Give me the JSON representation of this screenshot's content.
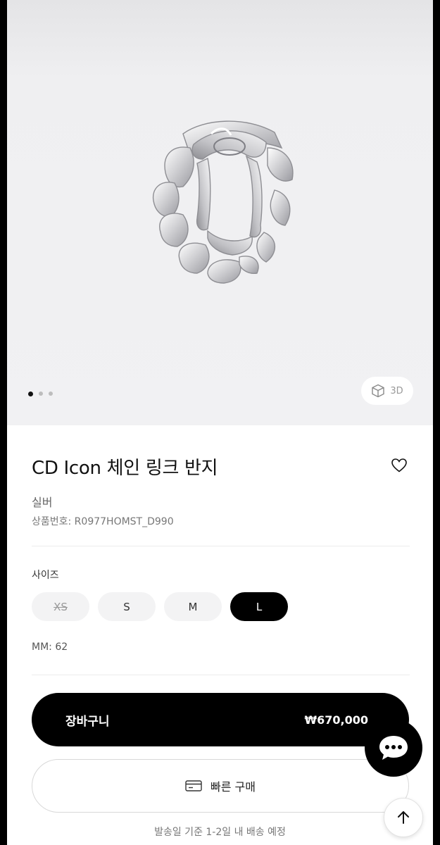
{
  "gallery": {
    "image_alt": "ring-product-image",
    "dots_count": 3,
    "active_dot": 0,
    "view_3d_label": "3D"
  },
  "product": {
    "title": "CD Icon 체인 링크 반지",
    "color": "실버",
    "sku": "상품번호: R0977HOMST_D990"
  },
  "size": {
    "label": "사이즈",
    "options": [
      {
        "label": "XS",
        "state": "disabled"
      },
      {
        "label": "S",
        "state": "available"
      },
      {
        "label": "M",
        "state": "available"
      },
      {
        "label": "L",
        "state": "selected"
      }
    ],
    "mm_text": "MM: 62"
  },
  "actions": {
    "cart_label": "장바구니",
    "price": "₩670,000",
    "quick_buy_label": "빠른 구매",
    "shipping_note": "발송일 기준 1-2일 내 배송 예정"
  },
  "icons": {
    "heart": "heart-icon",
    "cube": "cube-3d-icon",
    "card": "card-icon",
    "chat": "chat-icon",
    "arrow_up": "arrow-up-icon"
  }
}
